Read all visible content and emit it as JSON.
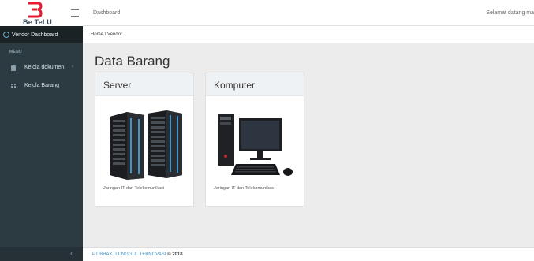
{
  "header": {
    "logo_text": "Be Tel U",
    "title": "Dashboard",
    "welcome": "Selamat datang ma"
  },
  "sidebar": {
    "active_label": "Vendor Dashboard",
    "menu_header": "MENU",
    "items": [
      {
        "label": "Kelola dokumen",
        "icon": "document-icon",
        "has_chevron": true
      },
      {
        "label": "Kelola Barang",
        "icon": "grid-icon",
        "has_chevron": false
      }
    ],
    "collapse_glyph": "‹"
  },
  "breadcrumb": "Home  /  Vendor",
  "main": {
    "title": "Data Barang",
    "cards": [
      {
        "title": "Server",
        "description": "Jaringan IT dan Telekomunikasi",
        "image": "server-rack-image"
      },
      {
        "title": "Komputer",
        "description": "Jaringan IT dan Telekomunikasi",
        "image": "desktop-computer-image"
      }
    ]
  },
  "footer": {
    "company": "PT BHAKTI UNGGUL TEKNOVASI",
    "year": "© 2018"
  },
  "colors": {
    "sidebar_bg": "#2c3b41",
    "sidebar_active_bg": "#1a2226",
    "logo_red": "#e31b2d",
    "footer_link": "#3c8dbc",
    "content_bg": "#ececec"
  }
}
